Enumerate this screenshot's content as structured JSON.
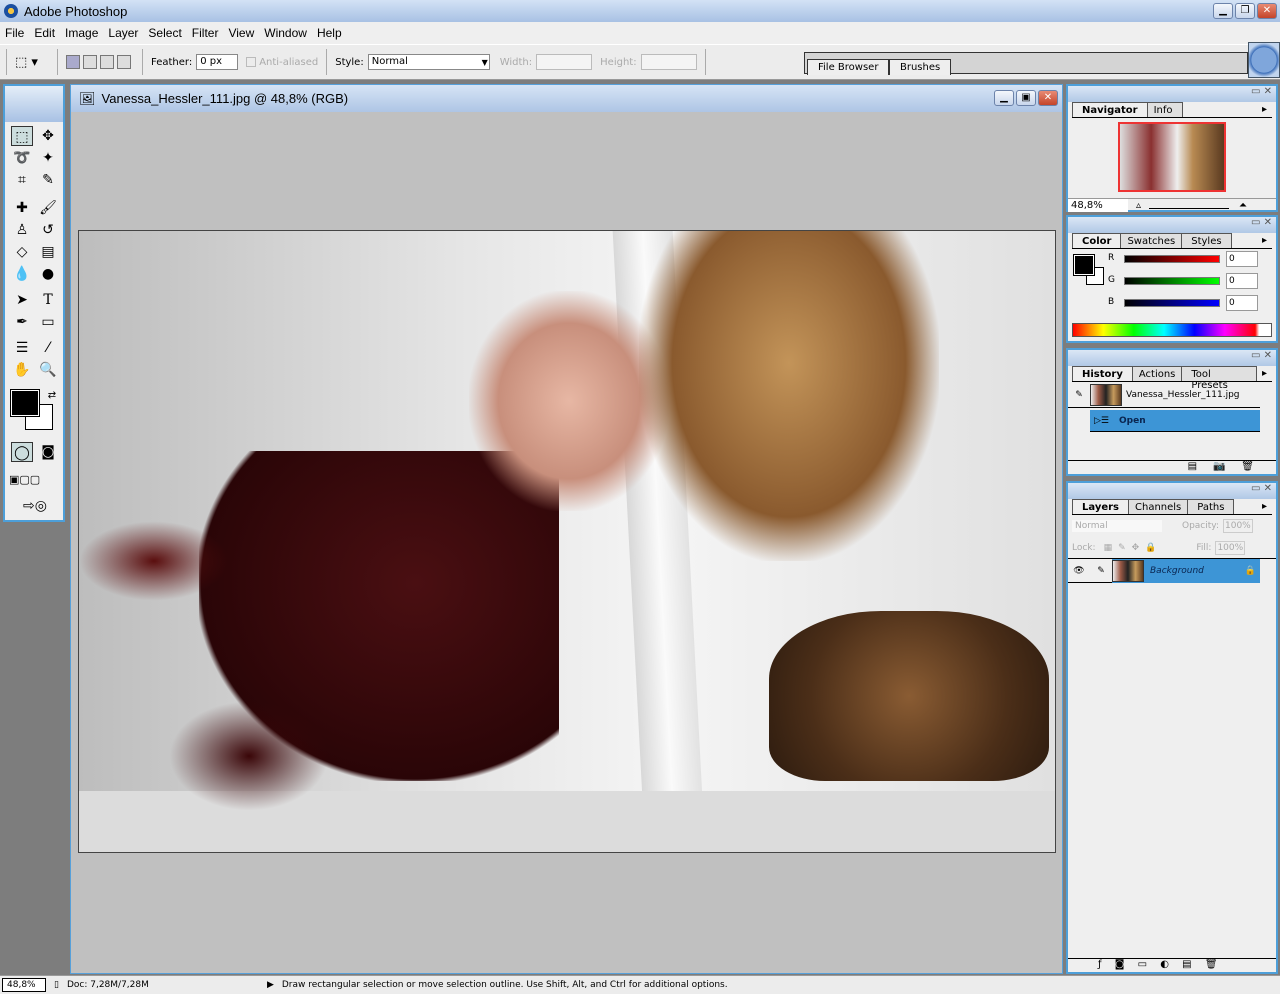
{
  "app": {
    "title": "Adobe Photoshop"
  },
  "menu": [
    "File",
    "Edit",
    "Image",
    "Layer",
    "Select",
    "Filter",
    "View",
    "Window",
    "Help"
  ],
  "options": {
    "feather_label": "Feather:",
    "feather_value": "0 px",
    "antialias_label": "Anti-aliased",
    "style_label": "Style:",
    "style_value": "Normal",
    "width_label": "Width:",
    "height_label": "Height:"
  },
  "palette_well": {
    "tabs": [
      "File Browser",
      "Brushes"
    ]
  },
  "document": {
    "title": "Vanessa_Hessler_111.jpg @ 48,8% (RGB)"
  },
  "navigator": {
    "tabs": [
      "Navigator",
      "Info"
    ],
    "zoom": "48,8%"
  },
  "color": {
    "tabs": [
      "Color",
      "Swatches",
      "Styles"
    ],
    "channels": [
      {
        "label": "R",
        "value": "0"
      },
      {
        "label": "G",
        "value": "0"
      },
      {
        "label": "B",
        "value": "0"
      }
    ],
    "foreground": "#000000",
    "background": "#ffffff"
  },
  "history": {
    "tabs": [
      "History",
      "Actions",
      "Tool Presets"
    ],
    "snapshot": "Vanessa_Hessler_111.jpg",
    "states": [
      "Open"
    ]
  },
  "layers": {
    "tabs": [
      "Layers",
      "Channels",
      "Paths"
    ],
    "blend_mode": "Normal",
    "opacity_label": "Opacity:",
    "opacity": "100%",
    "lock_label": "Lock:",
    "fill_label": "Fill:",
    "fill": "100%",
    "items": [
      "Background"
    ]
  },
  "status": {
    "zoom": "48,8%",
    "doc": "Doc: 7,28M/7,28M",
    "hint": "Draw rectangular selection or move selection outline.  Use Shift, Alt, and Ctrl for additional options."
  },
  "colors": {
    "accent": "#3d95d6",
    "panel_border": "#4d9fd9"
  }
}
